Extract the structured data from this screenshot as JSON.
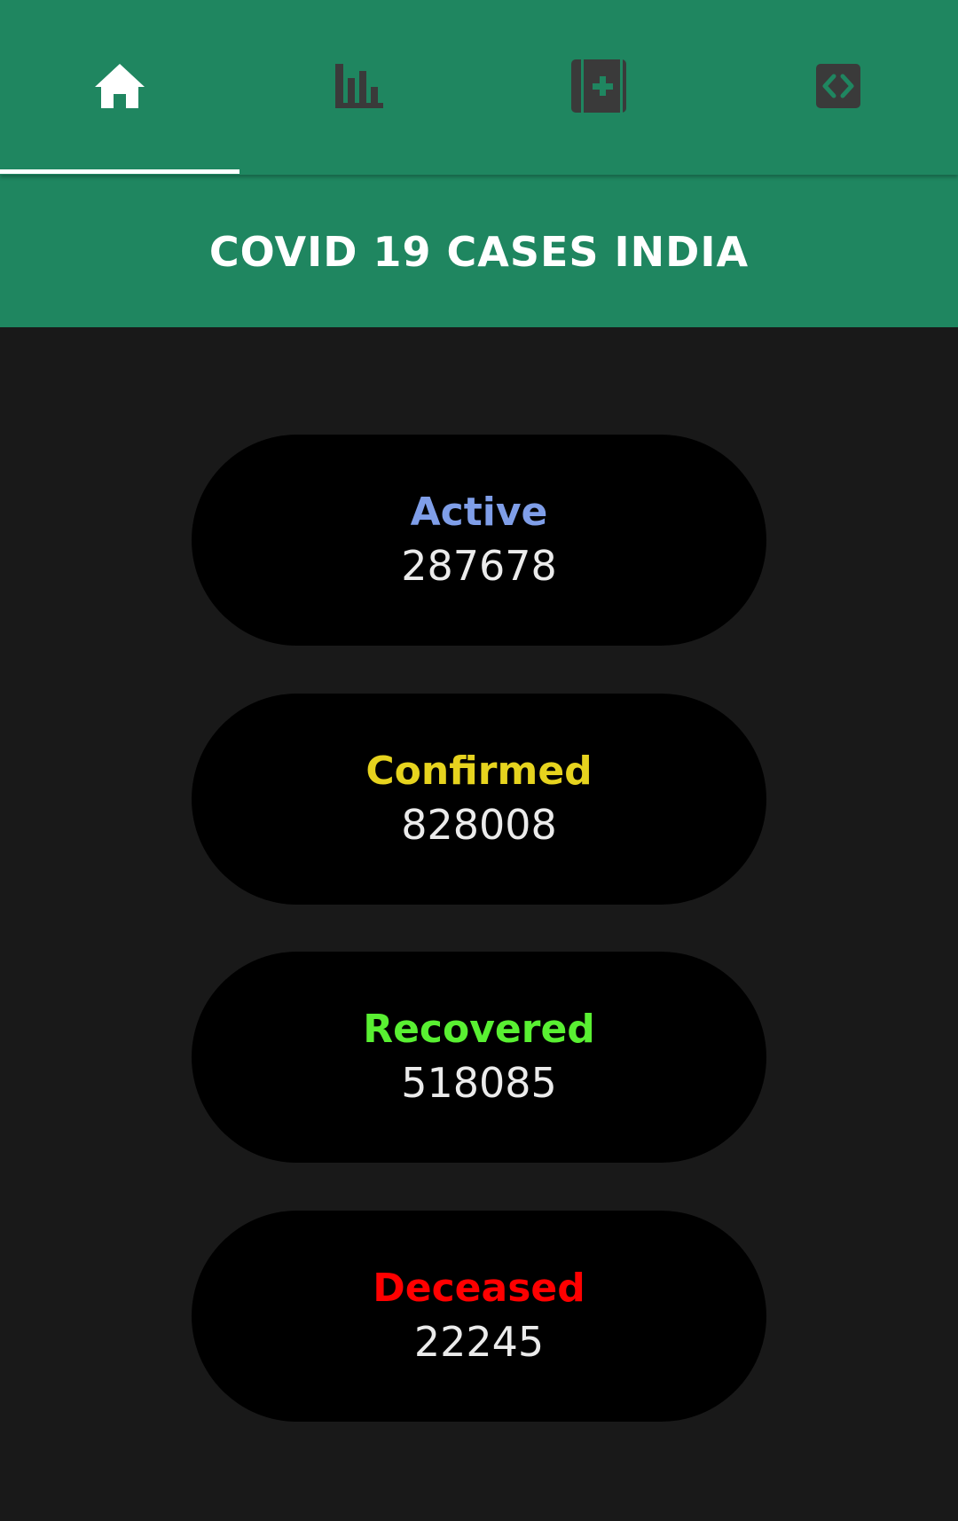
{
  "tabs": [
    {
      "name": "home",
      "icon": "home-icon",
      "active": true
    },
    {
      "name": "charts",
      "icon": "bar-chart-icon",
      "active": false
    },
    {
      "name": "medical",
      "icon": "medical-book-icon",
      "active": false
    },
    {
      "name": "code",
      "icon": "code-icon",
      "active": false
    }
  ],
  "colors": {
    "primary": "#1f8660",
    "background": "#191919",
    "card": "#000000",
    "inactive_icon": "#3a3a3a",
    "active_color": "#7f9ee8",
    "confirmed_color": "#e6d31e",
    "recovered_color": "#59f032",
    "deceased_color": "#ff0000"
  },
  "header": {
    "title": "COVID 19 CASES INDIA"
  },
  "stats": {
    "active": {
      "label": "Active",
      "value": "287678"
    },
    "confirmed": {
      "label": "Confirmed",
      "value": "828008"
    },
    "recovered": {
      "label": "Recovered",
      "value": "518085"
    },
    "deceased": {
      "label": "Deceased",
      "value": "22245"
    }
  }
}
